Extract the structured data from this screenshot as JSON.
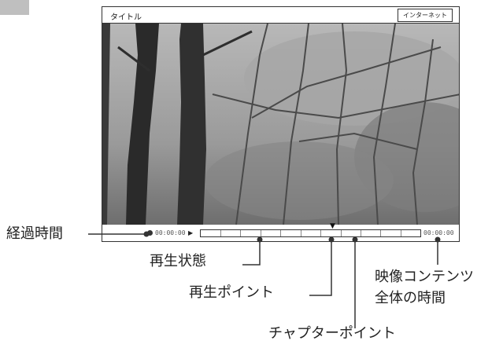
{
  "player": {
    "title": "タイトル",
    "internet_button": "インターネット",
    "elapsed_time": "00:00:00",
    "total_time": "00:00:00",
    "chapter_count": 11,
    "playback_position": 0.61
  },
  "callouts": {
    "elapsed": "経過時間",
    "playback_status": "再生状態",
    "playback_point": "再生ポイント",
    "total_line1": "映像コンテンツ",
    "total_line2": "全体の時間",
    "chapter_point": "チャプターポイント"
  },
  "icons": {
    "play": "play-icon",
    "marker": "position-marker-icon"
  }
}
